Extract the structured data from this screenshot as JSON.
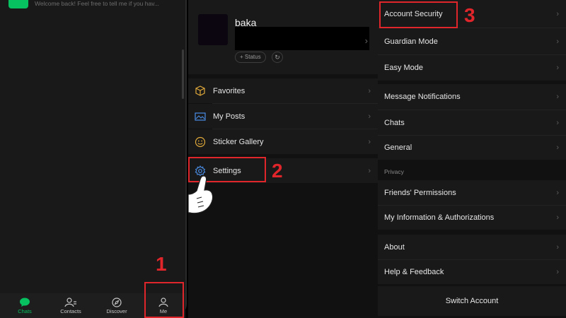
{
  "chats_screen": {
    "chat_preview": "Welcome back! Feel free to tell me if you hav...",
    "tabs": [
      {
        "label": "Chats",
        "icon": "chat-bubble-icon"
      },
      {
        "label": "Contacts",
        "icon": "contacts-icon"
      },
      {
        "label": "Discover",
        "icon": "compass-icon"
      },
      {
        "label": "Me",
        "icon": "person-icon"
      }
    ],
    "step_label": "1"
  },
  "me_screen": {
    "profile": {
      "name": "baka",
      "status_button": "+ Status",
      "refresh_icon": "refresh-icon"
    },
    "items": [
      {
        "label": "Favorites",
        "icon": "cube-icon"
      },
      {
        "label": "My Posts",
        "icon": "image-icon"
      },
      {
        "label": "Sticker Gallery",
        "icon": "smiley-icon"
      },
      {
        "label": "Settings",
        "icon": "gear-icon"
      }
    ],
    "step_label": "2"
  },
  "settings_screen": {
    "groups": [
      {
        "items": [
          "Account Security",
          "Guardian Mode",
          "Easy Mode"
        ]
      },
      {
        "items": [
          "Message Notifications",
          "Chats",
          "General"
        ]
      },
      {
        "title": "Privacy",
        "items": [
          "Friends' Permissions",
          "My Information & Authorizations"
        ]
      },
      {
        "items": [
          "About",
          "Help & Feedback"
        ]
      }
    ],
    "switch_account": "Switch Account",
    "step_label": "3"
  },
  "colors": {
    "accent_green": "#07c160",
    "highlight_red": "#e0252b",
    "icon_blue": "#4a8ee8",
    "icon_gold": "#e0a93a"
  }
}
